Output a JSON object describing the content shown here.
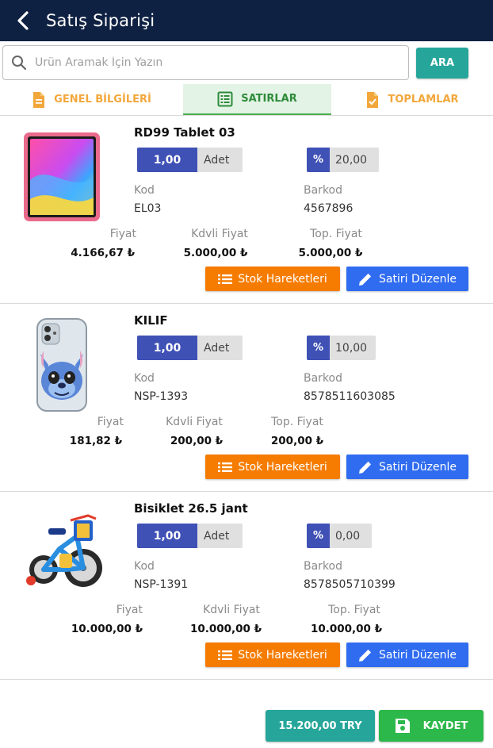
{
  "header": {
    "title": "Satış Siparişi",
    "back_icon": "chevron-left-icon"
  },
  "search": {
    "placeholder": "Ürün Aramak İçin Yazın",
    "value": "",
    "button_label": "ARA"
  },
  "tabs": [
    {
      "label": "GENEL BİLGİLERİ",
      "icon": "document-icon",
      "active": false
    },
    {
      "label": "SATIRLAR",
      "icon": "table-list-icon",
      "active": true
    },
    {
      "label": "TOPLAMLAR",
      "icon": "document-check-icon",
      "active": false
    }
  ],
  "labels": {
    "code": "Kod",
    "barcode": "Barkod",
    "price": "Fiyat",
    "price_vat": "Kdvli Fiyat",
    "total_price": "Top. Fiyat",
    "percent_symbol": "%",
    "stock_button": "Stok Hareketleri",
    "edit_button": "Satiri Düzenle"
  },
  "items": [
    {
      "name": "RD99 Tablet 03",
      "quantity": "1,00",
      "unit": "Adet",
      "discount": "20,00",
      "code": "EL03",
      "barcode": "4567896",
      "price": "4.166,67 ₺",
      "price_vat": "5.000,00 ₺",
      "total_price": "5.000,00 ₺",
      "image": "tablet-image"
    },
    {
      "name": "KILIF",
      "quantity": "1,00",
      "unit": "Adet",
      "discount": "10,00",
      "code": "NSP-1393",
      "barcode": "8578511603085",
      "price": "181,82 ₺",
      "price_vat": "200,00 ₺",
      "total_price": "200,00 ₺",
      "image": "phone-case-image"
    },
    {
      "name": "Bisiklet 26.5 jant",
      "quantity": "1,00",
      "unit": "Adet",
      "discount": "0,00",
      "code": "NSP-1391",
      "barcode": "8578505710399",
      "price": "10.000,00 ₺",
      "price_vat": "10.000,00 ₺",
      "total_price": "10.000,00 ₺",
      "image": "bicycle-image"
    }
  ],
  "footer": {
    "total": "15.200,00 TRY",
    "save_label": "KAYDET",
    "save_icon": "floppy-disk-icon"
  },
  "colors": {
    "header": "#0f2143",
    "teal": "#26a69a",
    "indigo": "#3f51b5",
    "orange": "#f57c00",
    "blue": "#2f6cf0",
    "green": "#2cb84a",
    "tab_orange": "#f2a73b",
    "tab_green": "#2e8b3a"
  }
}
